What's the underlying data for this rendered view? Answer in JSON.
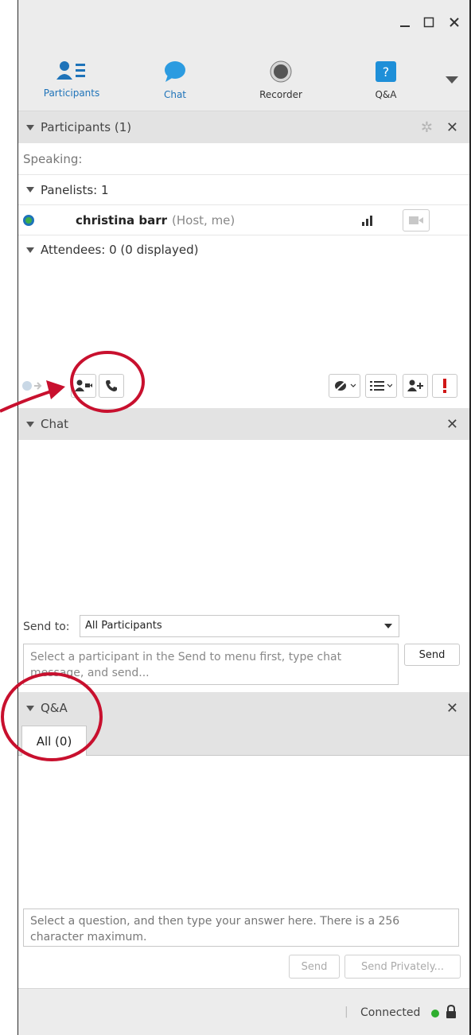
{
  "toolbar": {
    "items": [
      {
        "label": "Participants",
        "icon": "participants-icon"
      },
      {
        "label": "Chat",
        "icon": "chat-bubble-icon"
      },
      {
        "label": "Recorder",
        "icon": "record-icon"
      },
      {
        "label": "Q&A",
        "icon": "question-icon"
      }
    ]
  },
  "participants": {
    "header": "Participants (1)",
    "speaking": "Speaking:",
    "panelists": "Panelists: 1",
    "member": {
      "name": "christina barr",
      "role": "(Host, me)"
    },
    "attendees": "Attendees: 0 (0 displayed)"
  },
  "chat": {
    "header": "Chat",
    "send_to_label": "Send to:",
    "send_to_value": "All Participants",
    "input_placeholder": "Select a participant in the Send to menu first, type chat message, and send...",
    "send_button": "Send"
  },
  "qa": {
    "header": "Q&A",
    "tab": "All (0)",
    "input_placeholder": "Select a question, and then type your answer here. There is a 256 character maximum.",
    "send_button": "Send",
    "send_privately_button": "Send Privately..."
  },
  "status": {
    "separator": "|",
    "text": "Connected",
    "dot_color": "#2eae2e"
  },
  "colors": {
    "accent": "#1e73b9",
    "annotation": "#c8102e"
  }
}
